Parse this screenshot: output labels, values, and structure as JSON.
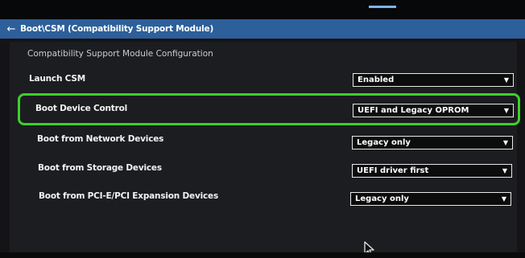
{
  "breadcrumb": {
    "back_icon": "back-arrow-icon",
    "path": "Boot\\CSM (Compatibility Support Module)"
  },
  "section_title": "Compatibility Support Module Configuration",
  "settings": [
    {
      "label": "Launch CSM",
      "value": "Enabled"
    },
    {
      "label": "Boot Device Control",
      "value": "UEFI and Legacy OPROM"
    },
    {
      "label": "Boot from Network Devices",
      "value": "Legacy only"
    },
    {
      "label": "Boot from Storage Devices",
      "value": "UEFI driver first"
    },
    {
      "label": "Boot from PCI-E/PCI Expansion Devices",
      "value": "Legacy only"
    }
  ],
  "dropdown_icon": "chevron-down-icon",
  "colors": {
    "breadcrumb_bar": "#2d5f9a",
    "highlight_box": "#3ecf2c",
    "accent_tick": "#7fb6e8"
  }
}
